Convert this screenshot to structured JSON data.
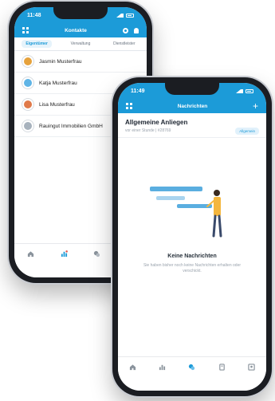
{
  "back_phone": {
    "status_time": "11:48",
    "title": "Kontakte",
    "tabs": [
      {
        "label": "Eigentümer",
        "active": true
      },
      {
        "label": "Verwaltung",
        "active": false
      },
      {
        "label": "Dienstleister",
        "active": false
      }
    ],
    "contacts": [
      {
        "name": "Jasmin Musterfrau",
        "avatar_color": "#e6a23c"
      },
      {
        "name": "Katja Musterfrau",
        "avatar_color": "#5fb4e6"
      },
      {
        "name": "Lisa Musterfrau",
        "avatar_color": "#e07a4a"
      },
      {
        "name": "Rauingut Immobilien GmbH",
        "avatar_color": "#a7b2bd"
      }
    ]
  },
  "front_phone": {
    "status_time": "11:49",
    "title": "Nachrichten",
    "conversation": {
      "title": "Allgemeine Anliegen",
      "subtitle": "vor einer Stunde | #28769",
      "badge": "Allgemein"
    },
    "empty_state": {
      "title": "Keine Nachrichten",
      "text": "Sie haben bisher noch keine Nachrichten erhalten oder verschickt."
    }
  },
  "colors": {
    "accent": "#1c9bd8",
    "background": "#ffffff"
  },
  "icons": {
    "menu": "grid-icon",
    "settings": "gear-icon",
    "notifications": "bell-icon",
    "add": "plus-icon",
    "nav": [
      "home-icon",
      "dashboard-icon",
      "chat-icon",
      "documents-icon",
      "contacts-icon"
    ]
  }
}
